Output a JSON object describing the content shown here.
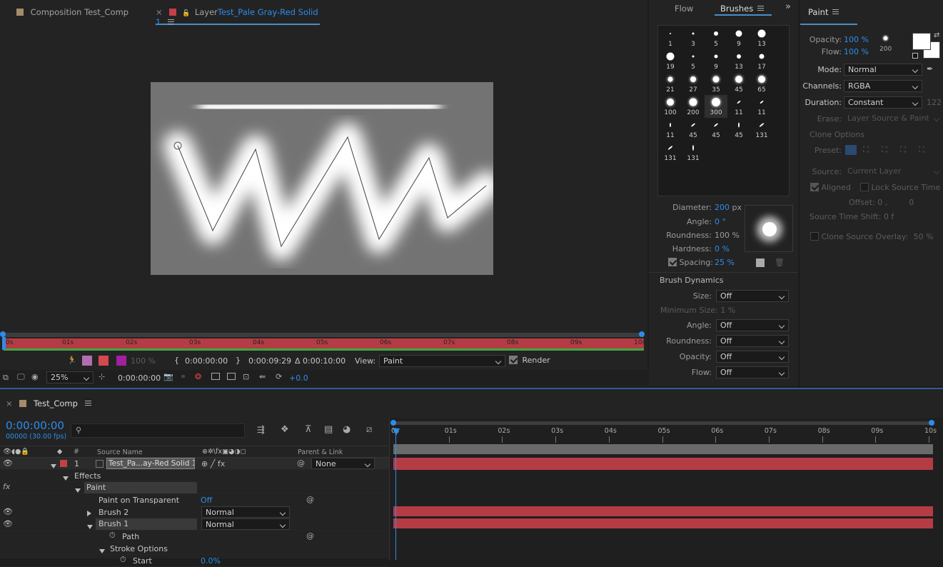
{
  "viewer": {
    "tabs": [
      {
        "label": "Composition Test_Comp"
      },
      {
        "label": "Layer",
        "name": "Test_Pale Gray-Red Solid 1"
      }
    ],
    "close": "×",
    "ruler": [
      "0s",
      "01s",
      "02s",
      "03s",
      "04s",
      "05s",
      "06s",
      "07s",
      "08s",
      "09s",
      "10s"
    ],
    "opacity": "100 %",
    "start": "0:00:00:00",
    "end": "0:00:09:29",
    "duration": "Δ 0:00:10:00",
    "view_label": "View:",
    "view_value": "Paint",
    "render_label": "Render",
    "zoom": "25%",
    "timecode": "0:00:00:00",
    "exposure": "+0.0"
  },
  "brushes": {
    "tabs": [
      "Flow",
      "Brushes"
    ],
    "tips": [
      "1",
      "3",
      "5",
      "9",
      "13",
      "19",
      "5",
      "9",
      "13",
      "17",
      "21",
      "27",
      "35",
      "45",
      "65",
      "100",
      "200",
      "300",
      "11",
      "11",
      "11",
      "45",
      "45",
      "45",
      "131",
      "131",
      "131"
    ],
    "diameter_label": "Diameter:",
    "diameter": "200",
    "diameter_unit": "px",
    "angle_label": "Angle:",
    "angle": "0 °",
    "roundness_label": "Roundness:",
    "roundness": "100 %",
    "hardness_label": "Hardness:",
    "hardness": "0 %",
    "spacing_label": "Spacing:",
    "spacing": "25 %",
    "dynamics_title": "Brush Dynamics",
    "dynamics": [
      {
        "label": "Size:",
        "value": "Off"
      },
      {
        "label": "Angle:",
        "value": "Off"
      },
      {
        "label": "Roundness:",
        "value": "Off"
      },
      {
        "label": "Opacity:",
        "value": "Off"
      },
      {
        "label": "Flow:",
        "value": "Off"
      }
    ],
    "min_size_label": "Minimum Size:",
    "min_size": "1 %"
  },
  "paint": {
    "title": "Paint",
    "opacity_label": "Opacity:",
    "opacity": "100 %",
    "flow_label": "Flow:",
    "flow": "100 %",
    "brush_size": "200",
    "mode_label": "Mode:",
    "mode": "Normal",
    "channels_label": "Channels:",
    "channels": "RGBA",
    "duration_label": "Duration:",
    "duration": "Constant",
    "duration_num": "122",
    "erase_label": "Erase:",
    "erase": "Layer Source & Paint",
    "clone_options": "Clone Options",
    "preset_label": "Preset:",
    "source_label": "Source:",
    "source": "Current Layer",
    "aligned": "Aligned",
    "lock_source_time": "Lock Source Time",
    "offset_label": "Offset:",
    "offset_x": "0 ,",
    "offset_y": "0",
    "sts_label": "Source Time Shift:",
    "sts": "0 f",
    "overlay_label": "Clone Source Overlay:",
    "overlay": "50 %"
  },
  "timeline": {
    "comp_name": "Test_Comp",
    "timecode": "0:00:00:00",
    "fps": "00000 (30.00 fps)",
    "search_placeholder": "",
    "ruler": [
      "0s",
      "01s",
      "02s",
      "03s",
      "04s",
      "05s",
      "06s",
      "07s",
      "08s",
      "09s",
      "10s"
    ],
    "col_hash": "#",
    "col_source": "Source Name",
    "col_parent": "Parent & Link",
    "layer_num": "1",
    "layer_name": "Test_Pa...ay-Red Solid 1",
    "parent": "None",
    "rows": {
      "effects": "Effects",
      "paint": "Paint",
      "pot": "Paint on Transparent",
      "pot_val": "Off",
      "brush2": "Brush 2",
      "brush2_mode": "Normal",
      "brush1": "Brush 1",
      "brush1_mode": "Normal",
      "path": "Path",
      "stroke": "Stroke Options",
      "start": "Start",
      "start_val": "0.0%"
    }
  },
  "colors": {
    "accent": "#2d8ceb",
    "layer_red": "#b53c44",
    "bar_red": "#b53c44"
  }
}
